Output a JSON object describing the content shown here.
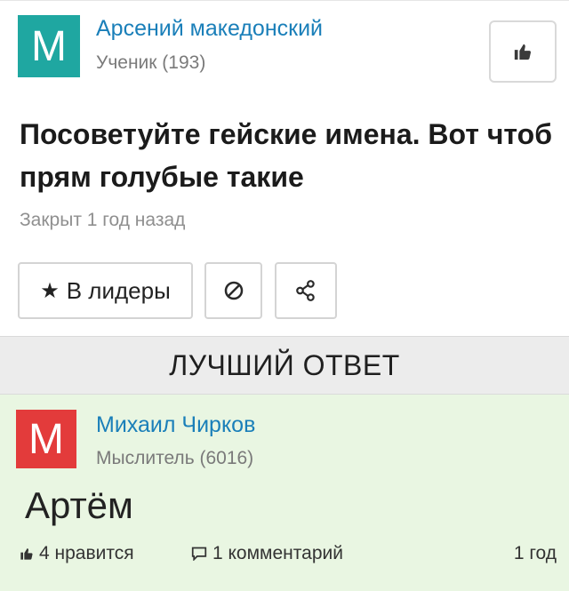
{
  "question": {
    "avatar_letter": "M",
    "author": "Арсений македонский",
    "rank": "Ученик (193)",
    "title": "Посоветуйте гейские имена. Вот чтоб прям голубые такие",
    "status": "Закрыт 1 год назад",
    "leaders_label": "В лидеры",
    "icons": [
      "thumbs-up-icon",
      "star-icon",
      "block-icon",
      "share-icon"
    ]
  },
  "best_answer": {
    "header": "ЛУЧШИЙ ОТВЕТ",
    "avatar_letter": "M",
    "author": "Михаил Чирков",
    "rank": "Мыслитель (6016)",
    "text": "Артём",
    "likes": "4 нравится",
    "comments": "1 комментарий",
    "age": "1 год",
    "icons": [
      "thumbs-up-icon",
      "comment-icon"
    ]
  },
  "colors": {
    "link": "#1a7fb9",
    "avatar_question": "#1fa7a1",
    "avatar_answer": "#e33b3b",
    "answer_bg": "#e9f6e2",
    "header_bg": "#ececec"
  }
}
